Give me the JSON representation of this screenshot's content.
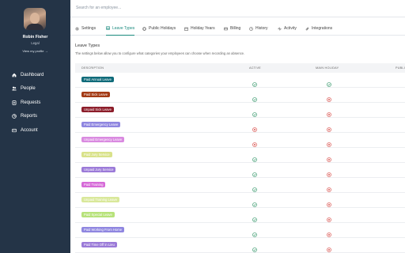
{
  "user": {
    "name": "Robin Fisher",
    "role": "Legal",
    "profile_link": "View my profile →"
  },
  "nav": [
    {
      "label": "Dashboard",
      "icon": "home-icon"
    },
    {
      "label": "People",
      "icon": "people-icon"
    },
    {
      "label": "Requests",
      "icon": "requests-icon"
    },
    {
      "label": "Reports",
      "icon": "reports-icon"
    },
    {
      "label": "Account",
      "icon": "account-icon"
    }
  ],
  "search": {
    "placeholder": "Search for an employee..."
  },
  "tabs": [
    {
      "label": "Settings",
      "icon": "gear-icon",
      "active": false
    },
    {
      "label": "Leave Types",
      "icon": "list-icon",
      "active": true
    },
    {
      "label": "Public Holidays",
      "icon": "globe-icon",
      "active": false
    },
    {
      "label": "Holiday Years",
      "icon": "calendar-icon",
      "active": false
    },
    {
      "label": "Billing",
      "icon": "card-icon",
      "active": false
    },
    {
      "label": "History",
      "icon": "clock-icon",
      "active": false
    },
    {
      "label": "Activity",
      "icon": "activity-icon",
      "active": false
    },
    {
      "label": "Integrations",
      "icon": "link-icon",
      "active": false
    }
  ],
  "section": {
    "title": "Leave Types",
    "description": "The settings below allow you to configure what categories your employees can choose when recording an absence."
  },
  "table": {
    "headers": {
      "description": "DESCRIPTION",
      "active": "ACTIVE",
      "main_holiday": "MAIN HOLIDAY",
      "public": "PUBLI"
    },
    "rows": [
      {
        "label": "Paid Annual Leave",
        "color": "#0f6b7a",
        "active": true,
        "main": true
      },
      {
        "label": "Paid Sick Leave",
        "color": "#a33a14",
        "active": true,
        "main": false
      },
      {
        "label": "Unpaid Sick Leave",
        "color": "#8c1d2a",
        "active": true,
        "main": false
      },
      {
        "label": "Paid Emergency Leave",
        "color": "#8f86e0",
        "active": false,
        "main": false
      },
      {
        "label": "Unpaid Emergency Leave",
        "color": "#d98ae0",
        "active": false,
        "main": false
      },
      {
        "label": "Paid Jury Service",
        "color": "#d9e28a",
        "active": true,
        "main": false
      },
      {
        "label": "Unpaid Jury Service",
        "color": "#9b7ad8",
        "active": true,
        "main": false
      },
      {
        "label": "Paid Training",
        "color": "#d66bd8",
        "active": true,
        "main": false
      },
      {
        "label": "Unpaid Training Leave",
        "color": "#d9e89a",
        "active": true,
        "main": false
      },
      {
        "label": "Paid Special Leave",
        "color": "#b7e27a",
        "active": true,
        "main": false
      },
      {
        "label": "Paid Working From Home",
        "color": "#8f86e0",
        "active": true,
        "main": false
      },
      {
        "label": "Paid Time Off in Lieu",
        "color": "#9b7ad8",
        "active": true,
        "main": false
      }
    ]
  },
  "colors": {
    "check": "#3a9a6e",
    "cross": "#d9534f",
    "accent": "#1a8a7e",
    "sidebar": "#243447"
  }
}
